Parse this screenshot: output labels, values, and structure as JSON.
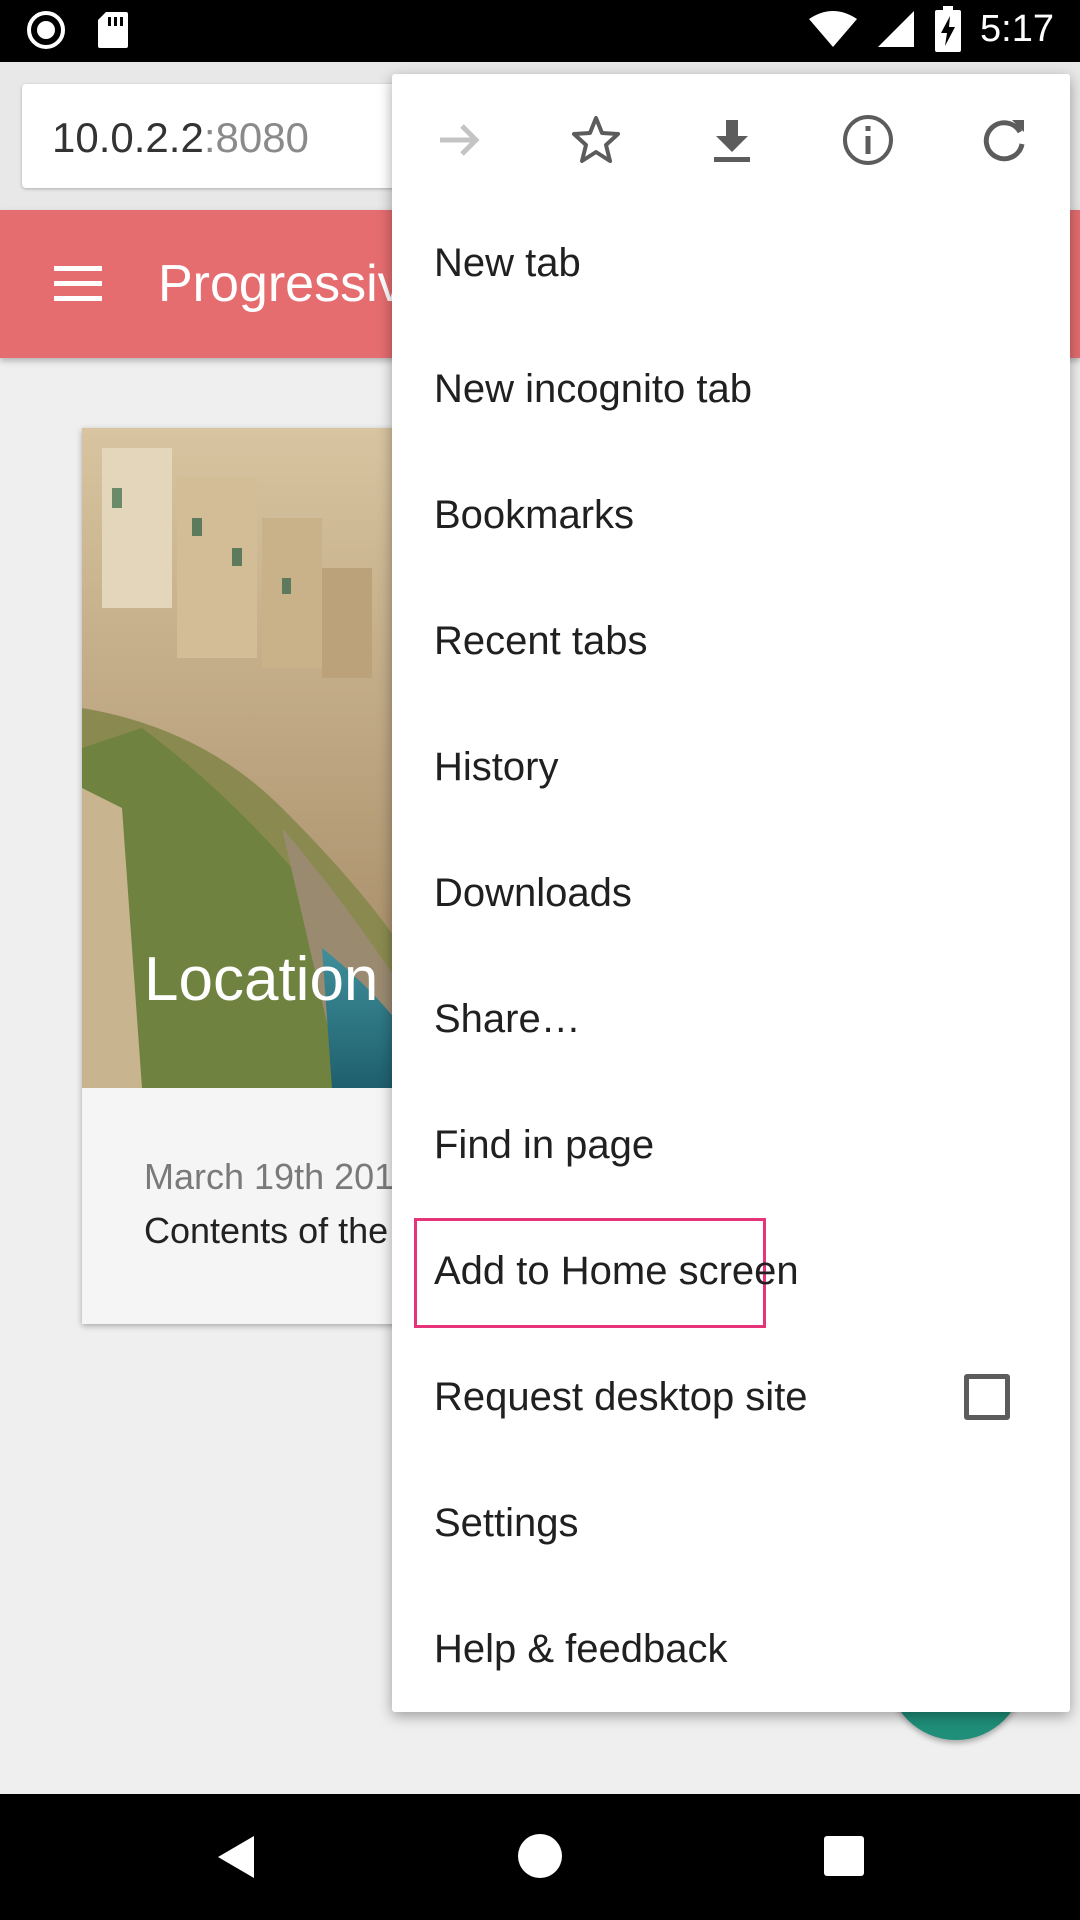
{
  "status_bar": {
    "time": "5:17",
    "icons": [
      "record-icon",
      "sd-card-icon",
      "wifi-icon",
      "signal-icon",
      "battery-charging-icon"
    ]
  },
  "browser": {
    "url_host": "10.0.2.2",
    "url_port": ":8080"
  },
  "app": {
    "title": "Progressive",
    "accent_color": "#e56d70"
  },
  "card": {
    "image_title": "Location",
    "date": "March 19th 201",
    "contents": "Contents of the"
  },
  "menu": {
    "toolbar_icons": [
      "forward-icon",
      "bookmark-star-icon",
      "download-icon",
      "info-icon",
      "reload-icon"
    ],
    "items": [
      {
        "label": "New tab"
      },
      {
        "label": "New incognito tab"
      },
      {
        "label": "Bookmarks"
      },
      {
        "label": "Recent tabs"
      },
      {
        "label": "History"
      },
      {
        "label": "Downloads"
      },
      {
        "label": "Share…"
      },
      {
        "label": "Find in page"
      },
      {
        "label": "Add to Home screen"
      },
      {
        "label": "Request desktop site"
      },
      {
        "label": "Settings"
      },
      {
        "label": "Help & feedback"
      }
    ],
    "highlight_color": "#e6347a"
  },
  "nav_bar": {
    "icons": [
      "back-icon",
      "home-icon",
      "recents-icon"
    ]
  }
}
